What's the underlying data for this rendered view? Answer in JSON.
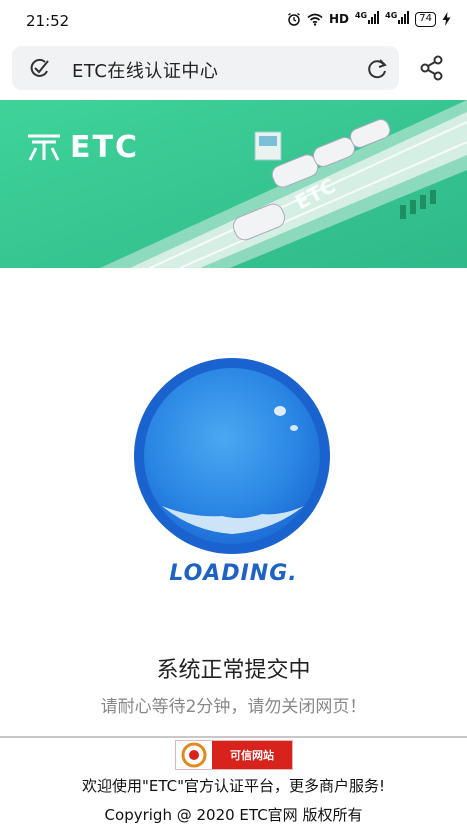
{
  "status_bar": {
    "time": "21:52",
    "network_label": "HD",
    "signal1_label": "4G",
    "signal2_label": "4G",
    "battery": "74"
  },
  "browser": {
    "url_title": "ETC在线认证中心"
  },
  "banner": {
    "logo_text": "ETC",
    "road_text": "ETC"
  },
  "loading": {
    "label": "LOADING."
  },
  "message": {
    "main": "系统正常提交中",
    "sub": "请耐心等待2分钟，请勿关闭网页！"
  },
  "footer": {
    "trust_badge_label": "可信网站",
    "line1": "欢迎使用\"ETC\"官方认证平台，更多商户服务!",
    "line2": "Copyrigh @ 2020 ETC官网 版权所有"
  },
  "colors": {
    "banner_green": "#3ed08f",
    "orb_blue": "#1f6fd8",
    "loading_text": "#1e63c4",
    "badge_red": "#d8221c"
  }
}
